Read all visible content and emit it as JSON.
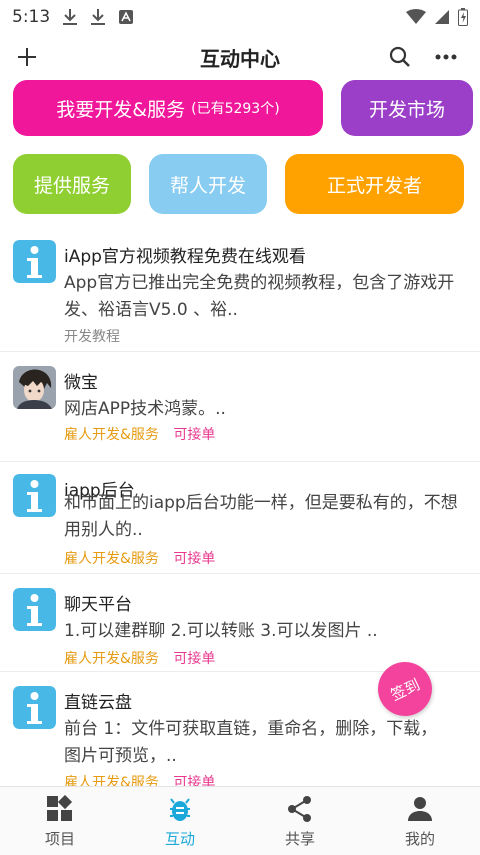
{
  "status_bar": {
    "time": "5:13"
  },
  "app_bar": {
    "title": "互动中心"
  },
  "actions": {
    "dev_label": "我要开发&服务",
    "dev_count": "(已有5293个)",
    "market_label": "开发市场",
    "provide_label": "提供服务",
    "help_label": "帮人开发",
    "formal_label": "正式开发者"
  },
  "feed": [
    {
      "title": "iApp官方视频教程免费在线观看",
      "desc": "App官方已推出完全免费的视频教程，包含了游戏开发、裕语言V5.0 、裕..",
      "tag1": "开发教程",
      "tag2": ""
    },
    {
      "title": "微宝",
      "desc": "网店APP技术鸿蒙。..",
      "tag1": "雇人开发&服务",
      "tag2": "可接单"
    },
    {
      "title": "iapp后台",
      "desc": "和市面上的iapp后台功能一样，但是要私有的，不想用别人的..",
      "tag1": "雇人开发&服务",
      "tag2": "可接单"
    },
    {
      "title": "聊天平台",
      "desc": "1.可以建群聊 2.可以转账 3.可以发图片 ..",
      "tag1": "雇人开发&服务",
      "tag2": "可接单"
    },
    {
      "title": "直链云盘",
      "desc": "前台 1：文件可获取直链，重命名，删除，下载，图片可预览，..",
      "tag1": "雇人开发&服务",
      "tag2": "可接单"
    }
  ],
  "sign_button": "签到",
  "bottom_nav": {
    "items": [
      {
        "label": "项目",
        "icon": "dashboard-icon"
      },
      {
        "label": "互动",
        "icon": "bug-icon"
      },
      {
        "label": "共享",
        "icon": "share-icon"
      },
      {
        "label": "我的",
        "icon": "person-icon"
      }
    ],
    "active_index": 1
  },
  "colors": {
    "dev": "#f0179a",
    "market": "#9b3fc8",
    "provide": "#8fcf32",
    "help": "#88ccf2",
    "formal": "#ffa200",
    "accent": "#1ca8d8"
  }
}
